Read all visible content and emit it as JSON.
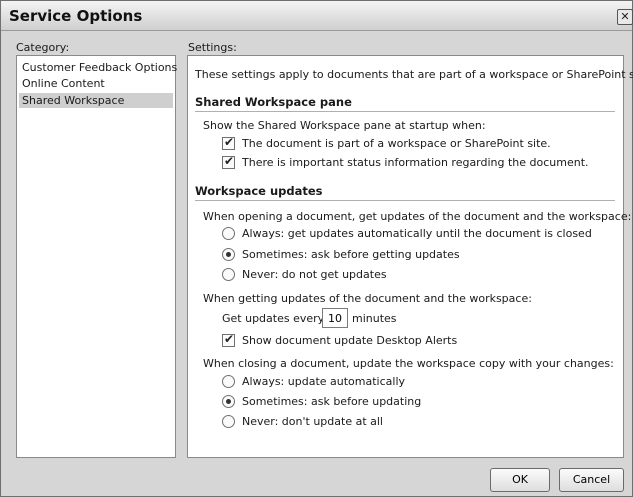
{
  "window": {
    "title": "Service Options",
    "close_glyph": "✕"
  },
  "category": {
    "label": "Category:",
    "items": [
      "Customer Feedback Options",
      "Online Content",
      "Shared Workspace"
    ],
    "selected_index": 2
  },
  "settings": {
    "label": "Settings:",
    "intro": "These settings apply to documents that are part of a workspace or SharePoint site.",
    "pane_section": {
      "heading": "Shared Workspace pane",
      "show_label": "Show the Shared Workspace pane at startup when:",
      "options": [
        {
          "label": "The document is part of a workspace or SharePoint site.",
          "checked": true
        },
        {
          "label": "There is important status information regarding the document.",
          "checked": true
        }
      ]
    },
    "updates_section": {
      "heading": "Workspace updates",
      "opening_label": "When opening a document, get updates of the document and the workspace:",
      "opening_options": [
        {
          "label": "Always: get updates automatically until the document is closed",
          "selected": false
        },
        {
          "label": "Sometimes: ask before getting updates",
          "selected": true
        },
        {
          "label": "Never: do not get updates",
          "selected": false
        }
      ],
      "getting_label": "When getting updates of the document and the workspace:",
      "get_every_prefix": "Get updates every",
      "get_every_value": "10",
      "get_every_suffix": "minutes",
      "desktop_alerts": {
        "label": "Show document update Desktop Alerts",
        "checked": true
      },
      "closing_label": "When closing a document, update the workspace copy with your changes:",
      "closing_options": [
        {
          "label": "Always: update automatically",
          "selected": false
        },
        {
          "label": "Sometimes: ask before updating",
          "selected": true
        },
        {
          "label": "Never: don't update at all",
          "selected": false
        }
      ]
    }
  },
  "buttons": {
    "ok": "OK",
    "cancel": "Cancel"
  },
  "icons": {
    "check": "check-icon",
    "close": "close-icon"
  }
}
